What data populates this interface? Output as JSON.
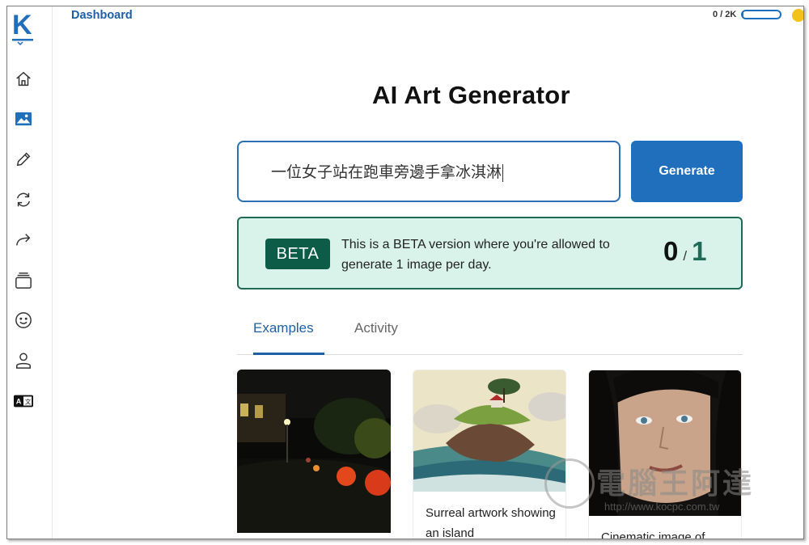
{
  "app": {
    "logo_letter": "K",
    "title": "Dashboard"
  },
  "quota": {
    "text": "0 / 2K",
    "fill_fraction": 0.02
  },
  "sidebar": {
    "items": [
      {
        "icon": "home-icon"
      },
      {
        "icon": "image-icon"
      },
      {
        "icon": "pencil-icon"
      },
      {
        "icon": "refresh-icon"
      },
      {
        "icon": "share-icon"
      },
      {
        "icon": "collection-icon"
      },
      {
        "icon": "smiley-icon"
      },
      {
        "icon": "user-icon"
      },
      {
        "icon": "translate-icon"
      }
    ]
  },
  "main": {
    "heading": "AI Art Generator",
    "prompt_value": "一位女子站在跑車旁邊手拿冰淇淋",
    "generate_label": "Generate",
    "beta": {
      "badge": "BETA",
      "message": "This is a BETA version where you're allowed to generate 1 image per day.",
      "used": "0",
      "separator": "/",
      "total": "1"
    },
    "tabs": [
      {
        "label": "Examples",
        "active": true
      },
      {
        "label": "Activity",
        "active": false
      }
    ],
    "cards": [
      {
        "caption": ""
      },
      {
        "caption": "Surreal artwork showing an island"
      },
      {
        "caption": "Cinematic image of"
      }
    ]
  },
  "watermark": {
    "text": "電腦王阿達",
    "url": "http://www.kocpc.com.tw"
  },
  "colors": {
    "accent": "#1f6fbd",
    "beta_bg": "#d9f3ea",
    "beta_dark": "#0d5c47"
  }
}
